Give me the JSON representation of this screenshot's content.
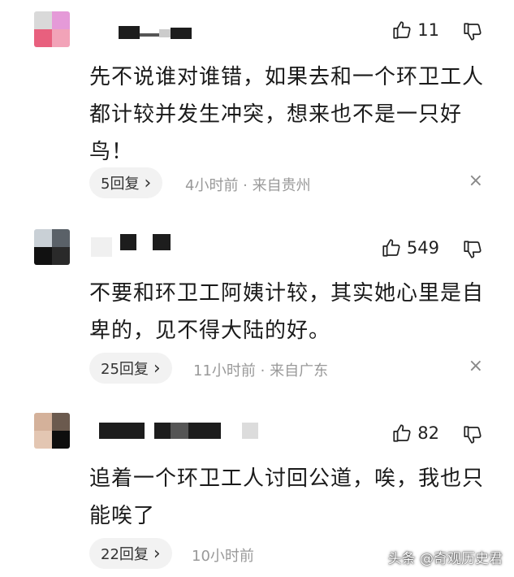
{
  "comments": [
    {
      "likes": "11",
      "text": "先不说谁对谁错，如果去和一个环卫工人都计较并发生冲突，想来也不是一只好鸟！",
      "reply_label": "5回复",
      "chevron": "›",
      "meta": "4小时前 · 来自贵州",
      "close": "×"
    },
    {
      "likes": "549",
      "text": "不要和环卫工阿姨计较，其实她心里是自卑的，见不得大陆的好。",
      "reply_label": "25回复",
      "chevron": "›",
      "meta": "11小时前 · 来自广东",
      "close": "×"
    },
    {
      "likes": "82",
      "text": "追着一个环卫工人讨回公道，唉，我也只能唉了",
      "reply_label": "22回复",
      "chevron": "›",
      "meta": "10小时前"
    }
  ],
  "watermark": "头条 @奇观历史君",
  "colors": {
    "background": "#ffffff",
    "pill": "#f2f2f2",
    "meta": "#999999"
  },
  "icons": [
    "thumbs-up-icon",
    "thumbs-down-icon",
    "close-icon",
    "chevron-right-icon"
  ]
}
